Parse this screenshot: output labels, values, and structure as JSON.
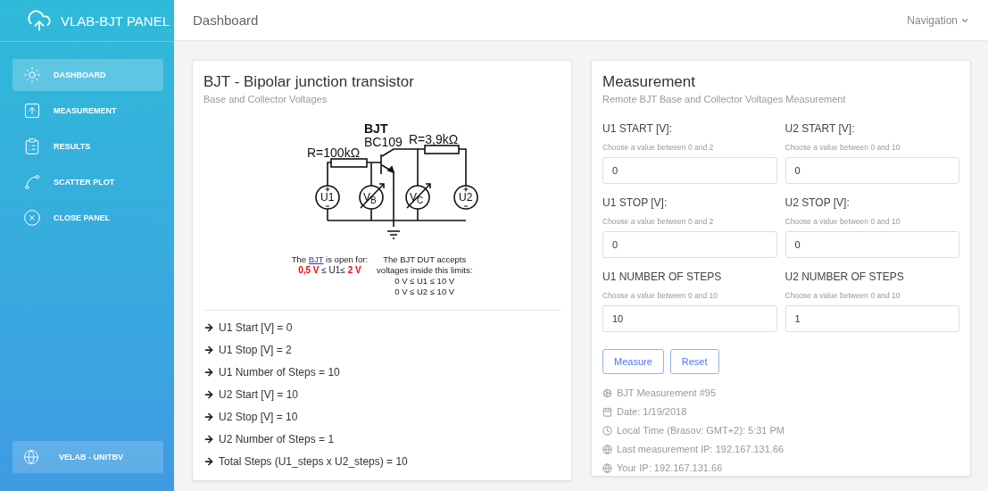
{
  "sidebar": {
    "brand": "VLAB-BJT PANEL",
    "items": [
      {
        "label": "DASHBOARD",
        "selected": true
      },
      {
        "label": "MEASUREMENT",
        "selected": false
      },
      {
        "label": "RESULTS",
        "selected": false
      },
      {
        "label": "SCATTER PLOT",
        "selected": false
      },
      {
        "label": "CLOSE PANEL",
        "selected": false
      }
    ],
    "footer": "VELAB - UNITBV"
  },
  "header": {
    "title": "Dashboard",
    "navigation": "Navigation"
  },
  "circuit_card": {
    "title": "BJT - Bipolar junction transistor",
    "subtitle": "Base and Collector Voltages",
    "circuit": {
      "transistor_type": "BJT",
      "transistor_model": "BC109",
      "base_resistor": "R=100kΩ",
      "collector_resistor": "R=3,9kΩ",
      "sources": [
        {
          "label": "U1",
          "kind": "source"
        },
        {
          "label": "V$_{B}$",
          "kind": "meter"
        },
        {
          "label": "V$_{C}$",
          "kind": "meter"
        },
        {
          "label": "U2",
          "kind": "source"
        }
      ]
    },
    "open_note": {
      "before": "The ",
      "link": "BJT",
      "after": " is open for:",
      "range": [
        {
          "text": "0,5 V",
          "color": "#ff0000"
        },
        {
          "text": " ≤ U1≤ "
        },
        {
          "text": "2 V",
          "color": "#ff0000"
        }
      ]
    },
    "limits_note": [
      "The BJT DUT accepts",
      "voltages inside this limits:",
      "0 V ≤ U1 ≤ 10 V",
      "0 V ≤ U2 ≤ 10 V"
    ],
    "summary": [
      "U1 Start [V] = 0",
      "U1 Stop [V] = 2",
      "U1 Number of Steps = 10",
      "U2 Start [V] = 10",
      "U2 Stop [V] = 10",
      "U2 Number of Steps = 1",
      "Total Steps (U1_steps x U2_steps) = 10"
    ]
  },
  "measurement_card": {
    "title": "Measurement",
    "subtitle": "Remote BJT Base and Collector Voltages Measurement",
    "fields": [
      {
        "label": "U1 START [V]:",
        "hint": "Choose a value between 0 and 2",
        "value": "0"
      },
      {
        "label": "U2 START [V]:",
        "hint": "Choose a value between 0 and 10",
        "value": "0"
      },
      {
        "label": "U1 STOP [V]:",
        "hint": "Choose a value between 0 and 2",
        "value": "0"
      },
      {
        "label": "U2 STOP [V]:",
        "hint": "Choose a value between 0 and 10",
        "value": "0"
      },
      {
        "label": "U1 NUMBER OF STEPS",
        "hint": "Choose a value between 0 and 10",
        "value": "10"
      },
      {
        "label": "U2 NUMBER OF STEPS",
        "hint": "Choose a value between 0 and 10",
        "value": "1"
      }
    ],
    "buttons": [
      "Measure",
      "Reset"
    ],
    "info": [
      "BJT Measurement #95",
      "Date: 1/19/2018",
      "Local Time (Brasov: GMT+2): 5:31 PM",
      "Last measurement IP: 192.167.131.66",
      "Your IP: 192.167.131.66"
    ]
  }
}
